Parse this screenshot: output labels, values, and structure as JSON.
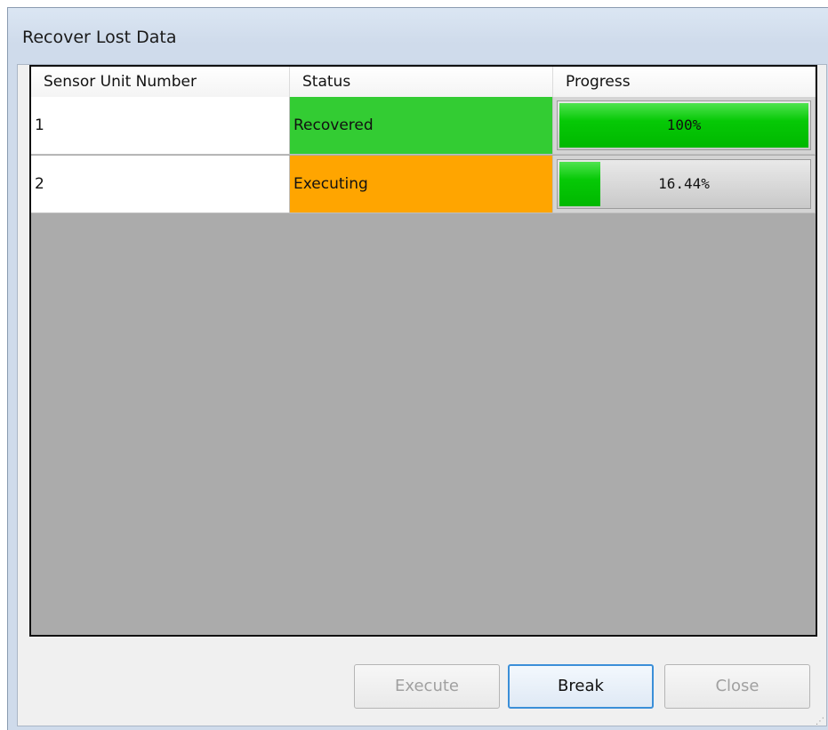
{
  "window": {
    "title": "Recover Lost Data"
  },
  "table": {
    "columns": [
      "Sensor Unit Number",
      "Status",
      "Progress"
    ],
    "rows": [
      {
        "unit": "1",
        "status": "Recovered",
        "status_color": "#33cc33",
        "progress": 1.0,
        "progress_label": "100%"
      },
      {
        "unit": "2",
        "status": "Executing",
        "status_color": "#ffa500",
        "progress": 0.1644,
        "progress_label": "16.44%"
      }
    ]
  },
  "buttons": {
    "execute": "Execute",
    "break": "Break",
    "close": "Close"
  },
  "colors": {
    "progress_fill": "#00c000",
    "grid_background": "#ababab"
  }
}
